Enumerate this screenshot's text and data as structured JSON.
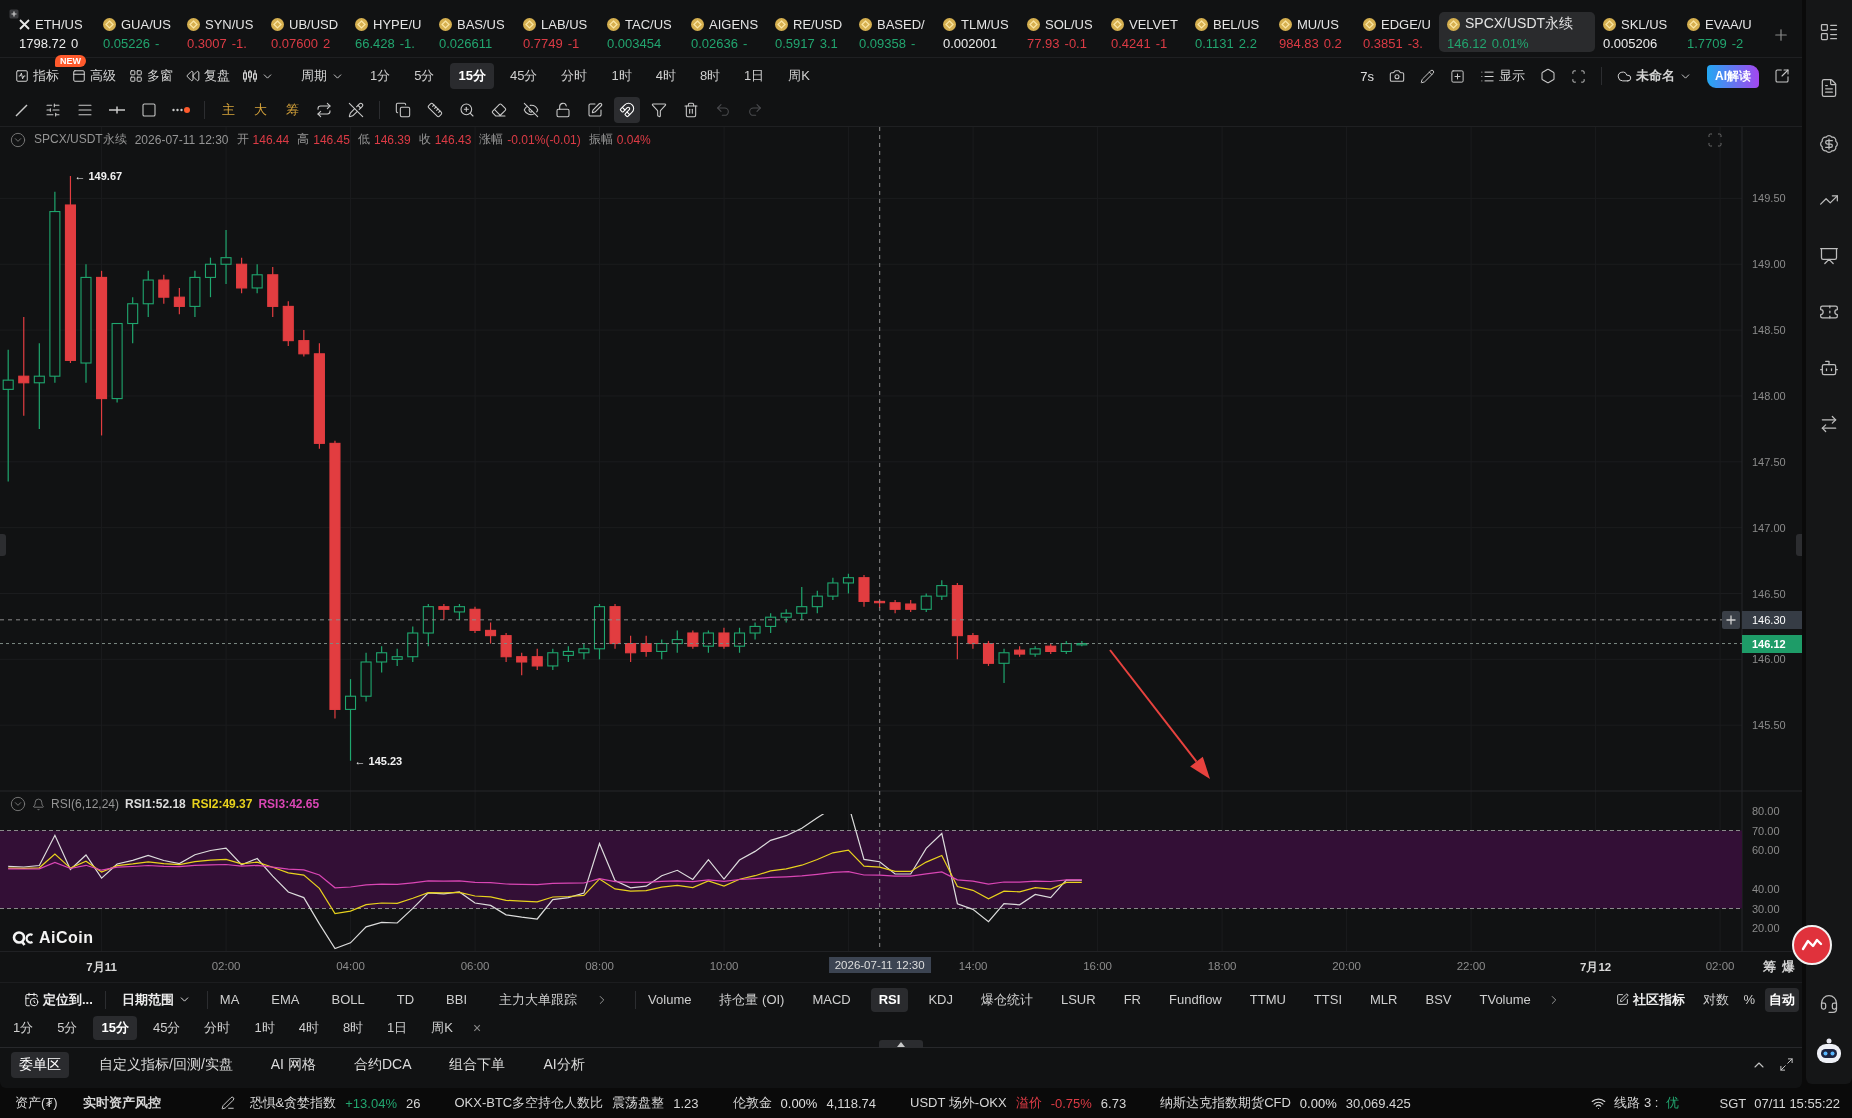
{
  "ticker_bar": {
    "items": [
      {
        "kind": "cross",
        "symbol": "ETH/US",
        "price": "1798.72",
        "change": "0",
        "color": "#ececec",
        "selected": false
      },
      {
        "kind": "coin",
        "symbol": "GUA/US",
        "price": "0.05226",
        "change": "-",
        "color": "#22a56f",
        "selected": false
      },
      {
        "kind": "coin",
        "symbol": "SYN/US",
        "price": "0.3007",
        "change": "-1.",
        "color": "#dc3b45",
        "selected": false
      },
      {
        "kind": "coin",
        "symbol": "UB/USD",
        "price": "0.07600",
        "change": "2",
        "color": "#dc3b45",
        "selected": false
      },
      {
        "kind": "coin",
        "symbol": "HYPE/U",
        "price": "66.428",
        "change": "-1.",
        "color": "#22a56f",
        "selected": false
      },
      {
        "kind": "coin",
        "symbol": "BAS/US",
        "price": "0.026611",
        "color": "#22a56f",
        "selected": false
      },
      {
        "kind": "coin",
        "symbol": "LAB/US",
        "price": "0.7749",
        "change": "-1",
        "color": "#dc3b45",
        "selected": false
      },
      {
        "kind": "coin",
        "symbol": "TAC/US",
        "price": "0.003454",
        "color": "#22a56f",
        "selected": false
      },
      {
        "kind": "coin",
        "symbol": "AIGENS",
        "price": "0.02636",
        "change": "-",
        "color": "#22a56f",
        "selected": false
      },
      {
        "kind": "coin",
        "symbol": "RE/USD",
        "price": "0.5917",
        "change": "3.1",
        "color": "#22a56f",
        "selected": false
      },
      {
        "kind": "coin",
        "symbol": "BASED/",
        "price": "0.09358",
        "change": "-",
        "color": "#22a56f",
        "selected": false
      },
      {
        "kind": "coin",
        "symbol": "TLM/US",
        "price": "0.002001",
        "color": "#ececec",
        "selected": false
      },
      {
        "kind": "coin",
        "symbol": "SOL/US",
        "price": "77.93",
        "change": "-0.1",
        "color": "#dc3b45",
        "selected": false
      },
      {
        "kind": "coin",
        "symbol": "VELVET",
        "price": "0.4241",
        "change": "-1",
        "color": "#dc3b45",
        "selected": false
      },
      {
        "kind": "coin",
        "symbol": "BEL/US",
        "price": "0.1131",
        "change": "2.2",
        "color": "#22a56f",
        "selected": false
      },
      {
        "kind": "coin",
        "symbol": "MU/US",
        "price": "984.83",
        "change": "0.2",
        "color": "#dc3b45",
        "selected": false
      },
      {
        "kind": "coin",
        "symbol": "EDGE/U",
        "price": "0.3851",
        "change": "-3.",
        "color": "#dc3b45",
        "selected": false
      },
      {
        "kind": "coin",
        "symbol": "SPCX/USDT永续",
        "price": "146.12",
        "change": "0.01%",
        "color": "#22a56f",
        "selected": true
      },
      {
        "kind": "coin",
        "symbol": "SKL/US",
        "price": "0.005206",
        "color": "#ececec",
        "selected": false
      },
      {
        "kind": "coin",
        "symbol": "EVAA/U",
        "price": "1.7709",
        "change": "-2",
        "color": "#22a56f",
        "selected": false
      }
    ]
  },
  "chart_toolbar": {
    "tools": [
      {
        "kind": "indicators",
        "label": "指标",
        "badge": "NEW"
      },
      {
        "kind": "advanced",
        "label": "高级"
      },
      {
        "kind": "windows",
        "label": "多窗"
      },
      {
        "kind": "replay",
        "label": "复盘"
      }
    ],
    "period_menu": "周期",
    "periods": [
      {
        "label": "1分",
        "selected": false
      },
      {
        "label": "5分",
        "selected": false
      },
      {
        "label": "15分",
        "selected": true
      },
      {
        "label": "45分",
        "selected": false
      },
      {
        "label": "分时",
        "selected": false
      },
      {
        "label": "1时",
        "selected": false
      },
      {
        "label": "4时",
        "selected": false
      },
      {
        "label": "8时",
        "selected": false
      },
      {
        "label": "1日",
        "selected": false
      },
      {
        "label": "周K",
        "selected": false
      }
    ],
    "refresh_interval": "7s",
    "display_button": "显示",
    "layout_name": "未命名",
    "ai_button": "AI解读"
  },
  "drawing_toolbar": {
    "draw_tools": [
      {
        "kind": "line"
      },
      {
        "kind": "channel"
      },
      {
        "kind": "lines"
      },
      {
        "kind": "ray"
      },
      {
        "kind": "rect"
      },
      {
        "kind": "more"
      }
    ],
    "overlay_tools": [
      {
        "kind": "text",
        "label": "主"
      },
      {
        "kind": "text",
        "label": "大"
      },
      {
        "kind": "text",
        "label": "筹"
      },
      {
        "kind": "swap"
      },
      {
        "kind": "hide"
      }
    ],
    "edit_tools": [
      {
        "kind": "copy",
        "selected": false,
        "disabled": false
      },
      {
        "kind": "ruler",
        "selected": false,
        "disabled": false
      },
      {
        "kind": "zoom",
        "selected": false,
        "disabled": false
      },
      {
        "kind": "eraser",
        "selected": false,
        "disabled": false
      },
      {
        "kind": "hide-links",
        "selected": false,
        "disabled": false
      },
      {
        "kind": "lock",
        "selected": false,
        "disabled": false
      },
      {
        "kind": "edit",
        "selected": false,
        "disabled": false
      },
      {
        "kind": "magnet",
        "selected": true,
        "disabled": false
      },
      {
        "kind": "filter",
        "selected": false,
        "disabled": false
      },
      {
        "kind": "trash",
        "selected": false,
        "disabled": false
      },
      {
        "kind": "undo",
        "selected": false,
        "disabled": true
      },
      {
        "kind": "redo",
        "selected": false,
        "disabled": true
      }
    ]
  },
  "chart_header": {
    "symbol": "SPCX/USDT永续",
    "time": "2026-07-11 12:30",
    "falling": true,
    "fields": [
      {
        "label": "开",
        "value": "146.44"
      },
      {
        "label": "高",
        "value": "146.45"
      },
      {
        "label": "低",
        "value": "146.39"
      },
      {
        "label": "收",
        "value": "146.43"
      },
      {
        "label": "涨幅",
        "value": "-0.01%(-0.01)"
      },
      {
        "label": "振幅",
        "value": "0.04%"
      }
    ]
  },
  "price_axis": {
    "labels": [
      "149.50",
      "149.00",
      "148.50",
      "148.00",
      "147.50",
      "147.00",
      "146.50",
      "146.00",
      "145.50"
    ],
    "crosshair_tag": "146.30",
    "last_price_tag": "146.12"
  },
  "chart_marks": {
    "high": "← 149.67",
    "low": "← 145.23"
  },
  "rsi": {
    "title": "RSI(6,12,24)",
    "lines": [
      {
        "label": "RSI1:52.18",
        "color": "#dcdcdc"
      },
      {
        "label": "RSI2:49.37",
        "color": "#e8d21d"
      },
      {
        "label": "RSI3:42.65",
        "color": "#d946b4"
      }
    ],
    "axis_labels": [
      "80.00",
      "70.00",
      "60.00",
      "40.00",
      "30.00",
      "20.00"
    ]
  },
  "logo": "AiCoin",
  "time_axis": {
    "labels": [
      {
        "text": "7月11",
        "kind": "day"
      },
      {
        "text": "02:00",
        "kind": "time"
      },
      {
        "text": "04:00",
        "kind": "time"
      },
      {
        "text": "06:00",
        "kind": "time"
      },
      {
        "text": "08:00",
        "kind": "time"
      },
      {
        "text": "10:00",
        "kind": "time"
      },
      {
        "text": "14:00",
        "kind": "time"
      },
      {
        "text": "16:00",
        "kind": "time"
      },
      {
        "text": "18:00",
        "kind": "time"
      },
      {
        "text": "20:00",
        "kind": "time"
      },
      {
        "text": "22:00",
        "kind": "time"
      },
      {
        "text": "7月12",
        "kind": "day"
      },
      {
        "text": "02:00",
        "kind": "time"
      }
    ],
    "crosshair_label": "2026-07-11 12:30",
    "side_toggles": [
      "筹",
      "爆"
    ]
  },
  "indicator_bar": {
    "locate_button": "定位到...",
    "date_range": "日期范围",
    "main_indicators": [
      "MA",
      "EMA",
      "BOLL",
      "TD",
      "BBI",
      "主力大单跟踪"
    ],
    "sub_indicators": [
      {
        "label": "Volume",
        "selected": false
      },
      {
        "label": "持仓量 (OI)",
        "selected": false
      },
      {
        "label": "MACD",
        "selected": false
      },
      {
        "label": "RSI",
        "selected": true
      },
      {
        "label": "KDJ",
        "selected": false
      },
      {
        "label": "爆仓统计",
        "selected": false
      },
      {
        "label": "LSUR",
        "selected": false
      },
      {
        "label": "FR",
        "selected": false
      },
      {
        "label": "Fundflow",
        "selected": false
      },
      {
        "label": "TTMU",
        "selected": false
      },
      {
        "label": "TTSI",
        "selected": false
      },
      {
        "label": "MLR",
        "selected": false
      },
      {
        "label": "BSV",
        "selected": false
      },
      {
        "label": "TVolume",
        "selected": false
      }
    ],
    "community_button": "社区指标",
    "scale_options": [
      {
        "label": "对数",
        "selected": false
      },
      {
        "label": "%",
        "selected": false
      },
      {
        "label": "自动",
        "selected": true
      }
    ]
  },
  "period_bar": {
    "periods": [
      {
        "label": "1分",
        "selected": false
      },
      {
        "label": "5分",
        "selected": false
      },
      {
        "label": "15分",
        "selected": true
      },
      {
        "label": "45分",
        "selected": false
      },
      {
        "label": "分时",
        "selected": false
      },
      {
        "label": "1时",
        "selected": false
      },
      {
        "label": "4时",
        "selected": false
      },
      {
        "label": "8时",
        "selected": false
      },
      {
        "label": "1日",
        "selected": false
      },
      {
        "label": "周K",
        "selected": false
      }
    ],
    "close": "×"
  },
  "bottom_panel": {
    "tabs": [
      {
        "label": "委单区",
        "selected": true
      },
      {
        "label": "自定义指标/回测/实盘",
        "selected": false
      },
      {
        "label": "AI 网格",
        "selected": false
      },
      {
        "label": "合约DCA",
        "selected": false
      },
      {
        "label": "组合下单",
        "selected": false
      },
      {
        "label": "AI分析",
        "selected": false
      }
    ]
  },
  "status_bar": {
    "asset_label": "资产(₮)",
    "risk_label": "实时资产风控",
    "metrics": [
      {
        "label": "恐惧&贪婪指数",
        "change": "+13.04%",
        "color": "#22a56f",
        "value": "26"
      },
      {
        "label": "OKX-BTC多空持仓人数比",
        "note": "震荡盘整",
        "value": "1.23"
      },
      {
        "label": "伦敦金",
        "change": "0.00%",
        "color": "#e0e0e0",
        "value": "4,118.74"
      },
      {
        "label": "USDT 场外-OKX",
        "note": "溢价",
        "change": "-0.75%",
        "color": "#dc3b45",
        "value": "6.73"
      },
      {
        "label": "纳斯达克指数期货CFD",
        "change": "0.00%",
        "color": "#e0e0e0",
        "value": "30,069.425"
      }
    ],
    "line_label": "线路 3 :",
    "line_quality": "优",
    "timezone": "SGT",
    "time": "07/11 15:55:22"
  }
}
